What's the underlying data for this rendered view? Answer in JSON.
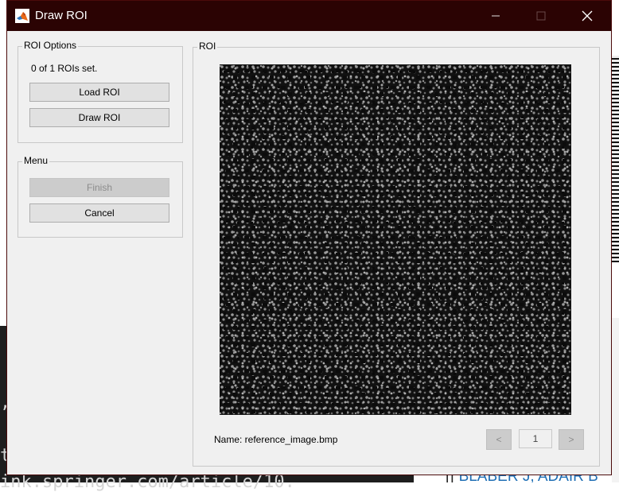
{
  "window": {
    "title": "Draw ROI"
  },
  "roi_options": {
    "legend": "ROI Options",
    "status": "0 of 1 ROIs set.",
    "load_label": "Load ROI",
    "draw_label": "Draw ROI"
  },
  "menu": {
    "legend": "Menu",
    "finish_label": "Finish",
    "cancel_label": "Cancel"
  },
  "roi_panel": {
    "legend": "ROI",
    "name_text": "Name: reference_image.bmp",
    "prev_label": "<",
    "page_value": "1",
    "next_label": ">"
  },
  "background": {
    "code_line_1": ",",
    "code_line_2": "t",
    "code_line_3": "ink.springer.com/article/10.",
    "reference_text": "BLABER J, ADAIR B"
  },
  "colors": {
    "titlebar": "#2b0303",
    "window_bg": "#f0f0f0",
    "image_bg": "#111111",
    "link": "#1f6fb5"
  }
}
